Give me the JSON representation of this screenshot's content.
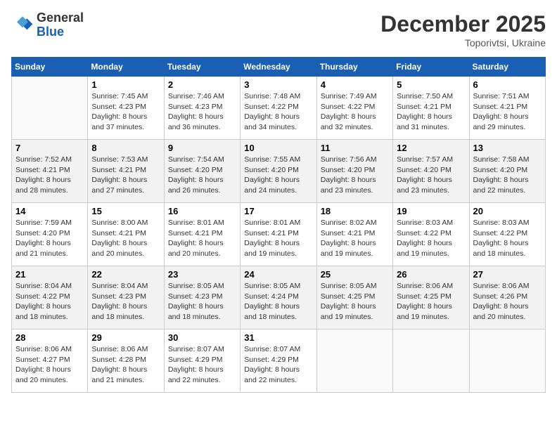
{
  "header": {
    "logo_general": "General",
    "logo_blue": "Blue",
    "month_title": "December 2025",
    "location": "Toporivtsi, Ukraine"
  },
  "weekdays": [
    "Sunday",
    "Monday",
    "Tuesday",
    "Wednesday",
    "Thursday",
    "Friday",
    "Saturday"
  ],
  "weeks": [
    [
      {
        "day": "",
        "text": ""
      },
      {
        "day": "1",
        "text": "Sunrise: 7:45 AM\nSunset: 4:23 PM\nDaylight: 8 hours\nand 37 minutes."
      },
      {
        "day": "2",
        "text": "Sunrise: 7:46 AM\nSunset: 4:23 PM\nDaylight: 8 hours\nand 36 minutes."
      },
      {
        "day": "3",
        "text": "Sunrise: 7:48 AM\nSunset: 4:22 PM\nDaylight: 8 hours\nand 34 minutes."
      },
      {
        "day": "4",
        "text": "Sunrise: 7:49 AM\nSunset: 4:22 PM\nDaylight: 8 hours\nand 32 minutes."
      },
      {
        "day": "5",
        "text": "Sunrise: 7:50 AM\nSunset: 4:21 PM\nDaylight: 8 hours\nand 31 minutes."
      },
      {
        "day": "6",
        "text": "Sunrise: 7:51 AM\nSunset: 4:21 PM\nDaylight: 8 hours\nand 29 minutes."
      }
    ],
    [
      {
        "day": "7",
        "text": "Sunrise: 7:52 AM\nSunset: 4:21 PM\nDaylight: 8 hours\nand 28 minutes."
      },
      {
        "day": "8",
        "text": "Sunrise: 7:53 AM\nSunset: 4:21 PM\nDaylight: 8 hours\nand 27 minutes."
      },
      {
        "day": "9",
        "text": "Sunrise: 7:54 AM\nSunset: 4:20 PM\nDaylight: 8 hours\nand 26 minutes."
      },
      {
        "day": "10",
        "text": "Sunrise: 7:55 AM\nSunset: 4:20 PM\nDaylight: 8 hours\nand 24 minutes."
      },
      {
        "day": "11",
        "text": "Sunrise: 7:56 AM\nSunset: 4:20 PM\nDaylight: 8 hours\nand 23 minutes."
      },
      {
        "day": "12",
        "text": "Sunrise: 7:57 AM\nSunset: 4:20 PM\nDaylight: 8 hours\nand 23 minutes."
      },
      {
        "day": "13",
        "text": "Sunrise: 7:58 AM\nSunset: 4:20 PM\nDaylight: 8 hours\nand 22 minutes."
      }
    ],
    [
      {
        "day": "14",
        "text": "Sunrise: 7:59 AM\nSunset: 4:20 PM\nDaylight: 8 hours\nand 21 minutes."
      },
      {
        "day": "15",
        "text": "Sunrise: 8:00 AM\nSunset: 4:21 PM\nDaylight: 8 hours\nand 20 minutes."
      },
      {
        "day": "16",
        "text": "Sunrise: 8:01 AM\nSunset: 4:21 PM\nDaylight: 8 hours\nand 20 minutes."
      },
      {
        "day": "17",
        "text": "Sunrise: 8:01 AM\nSunset: 4:21 PM\nDaylight: 8 hours\nand 19 minutes."
      },
      {
        "day": "18",
        "text": "Sunrise: 8:02 AM\nSunset: 4:21 PM\nDaylight: 8 hours\nand 19 minutes."
      },
      {
        "day": "19",
        "text": "Sunrise: 8:03 AM\nSunset: 4:22 PM\nDaylight: 8 hours\nand 19 minutes."
      },
      {
        "day": "20",
        "text": "Sunrise: 8:03 AM\nSunset: 4:22 PM\nDaylight: 8 hours\nand 18 minutes."
      }
    ],
    [
      {
        "day": "21",
        "text": "Sunrise: 8:04 AM\nSunset: 4:22 PM\nDaylight: 8 hours\nand 18 minutes."
      },
      {
        "day": "22",
        "text": "Sunrise: 8:04 AM\nSunset: 4:23 PM\nDaylight: 8 hours\nand 18 minutes."
      },
      {
        "day": "23",
        "text": "Sunrise: 8:05 AM\nSunset: 4:23 PM\nDaylight: 8 hours\nand 18 minutes."
      },
      {
        "day": "24",
        "text": "Sunrise: 8:05 AM\nSunset: 4:24 PM\nDaylight: 8 hours\nand 18 minutes."
      },
      {
        "day": "25",
        "text": "Sunrise: 8:05 AM\nSunset: 4:25 PM\nDaylight: 8 hours\nand 19 minutes."
      },
      {
        "day": "26",
        "text": "Sunrise: 8:06 AM\nSunset: 4:25 PM\nDaylight: 8 hours\nand 19 minutes."
      },
      {
        "day": "27",
        "text": "Sunrise: 8:06 AM\nSunset: 4:26 PM\nDaylight: 8 hours\nand 20 minutes."
      }
    ],
    [
      {
        "day": "28",
        "text": "Sunrise: 8:06 AM\nSunset: 4:27 PM\nDaylight: 8 hours\nand 20 minutes."
      },
      {
        "day": "29",
        "text": "Sunrise: 8:06 AM\nSunset: 4:28 PM\nDaylight: 8 hours\nand 21 minutes."
      },
      {
        "day": "30",
        "text": "Sunrise: 8:07 AM\nSunset: 4:29 PM\nDaylight: 8 hours\nand 22 minutes."
      },
      {
        "day": "31",
        "text": "Sunrise: 8:07 AM\nSunset: 4:29 PM\nDaylight: 8 hours\nand 22 minutes."
      },
      {
        "day": "",
        "text": ""
      },
      {
        "day": "",
        "text": ""
      },
      {
        "day": "",
        "text": ""
      }
    ]
  ]
}
